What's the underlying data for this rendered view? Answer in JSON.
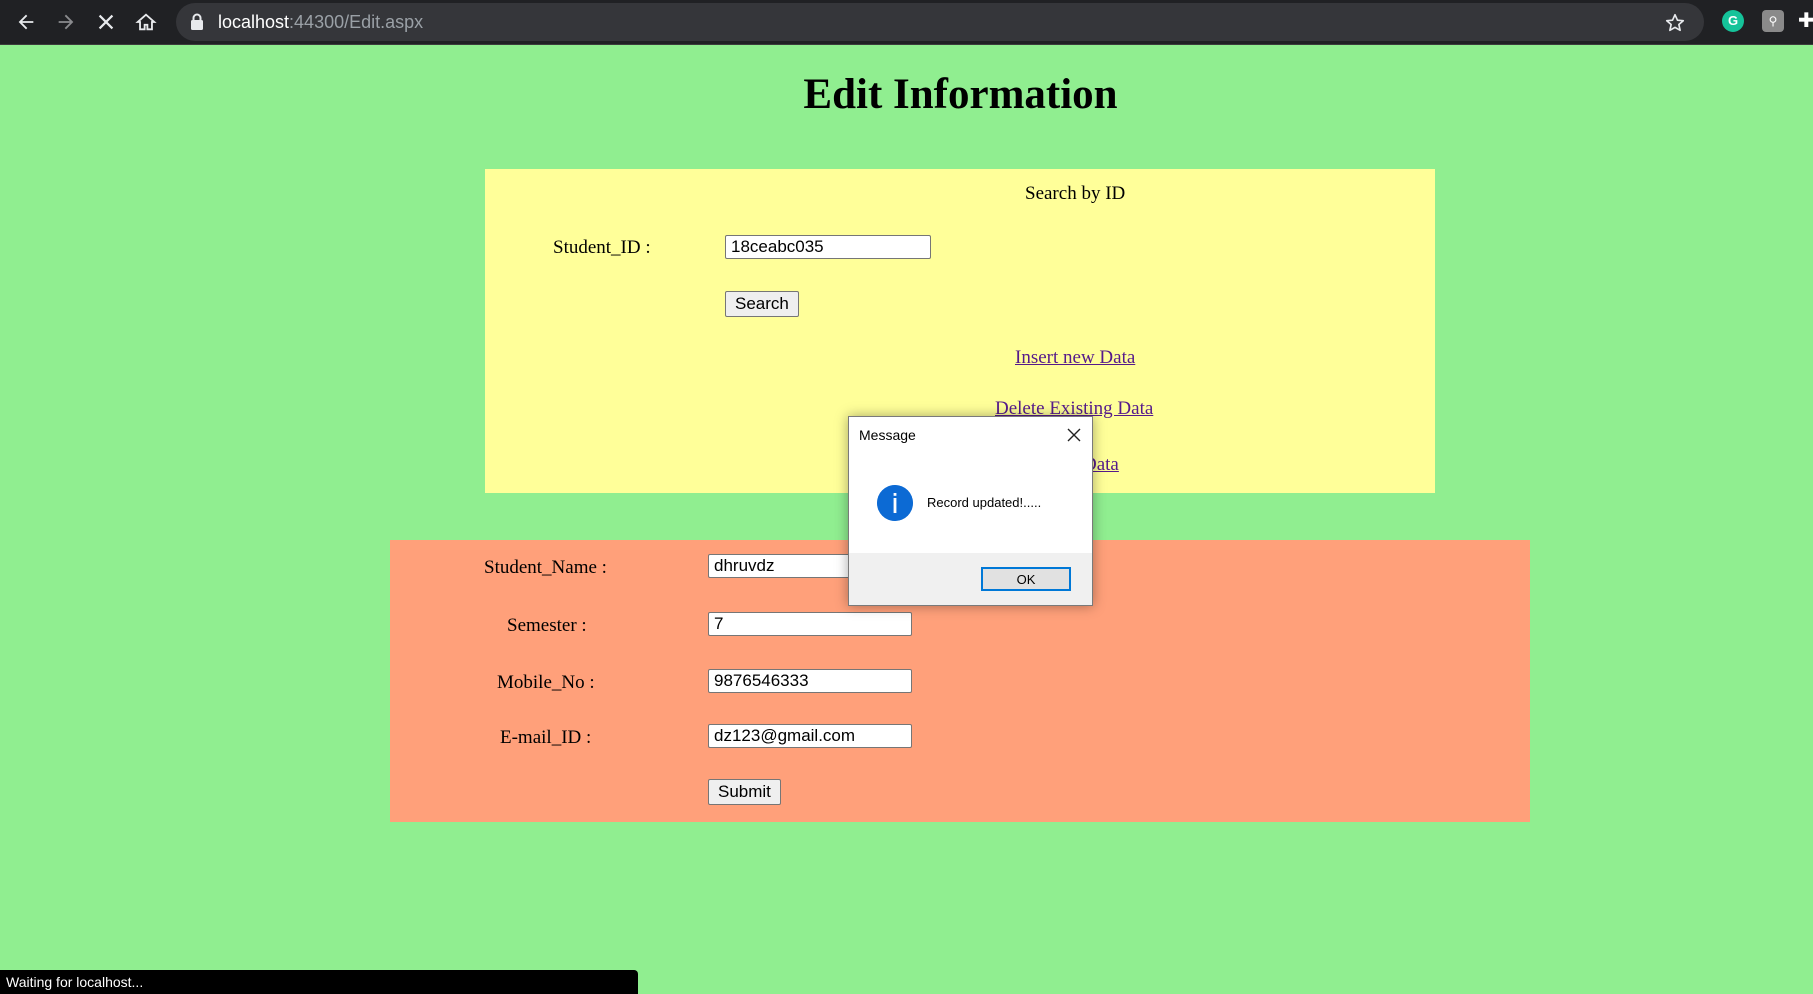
{
  "browser": {
    "url_host": "localhost",
    "url_rest": ":44300/Edit.aspx",
    "status_text": "Waiting for localhost..."
  },
  "page": {
    "title": "Edit Information"
  },
  "search": {
    "heading": "Search by ID",
    "student_id_label": "Student_ID :",
    "student_id_value": "18ceabc035",
    "search_button": "Search",
    "links": {
      "insert": "Insert new Data",
      "delete": "Delete Existing Data",
      "partial": "Data"
    }
  },
  "form": {
    "name_label": "Student_Name :",
    "name_value": "dhruvdz",
    "semester_label": "Semester :",
    "semester_value": "7",
    "mobile_label": "Mobile_No :",
    "mobile_value": "9876546333",
    "email_label": "E-mail_ID :",
    "email_value": "dz123@gmail.com",
    "submit_button": "Submit"
  },
  "dialog": {
    "title": "Message",
    "message": "Record updated!.....",
    "ok_button": "OK"
  },
  "colors": {
    "page_bg": "#90ee90",
    "search_panel_bg": "#ffff99",
    "form_panel_bg": "#ffa07a",
    "link_color": "#551a8b"
  }
}
